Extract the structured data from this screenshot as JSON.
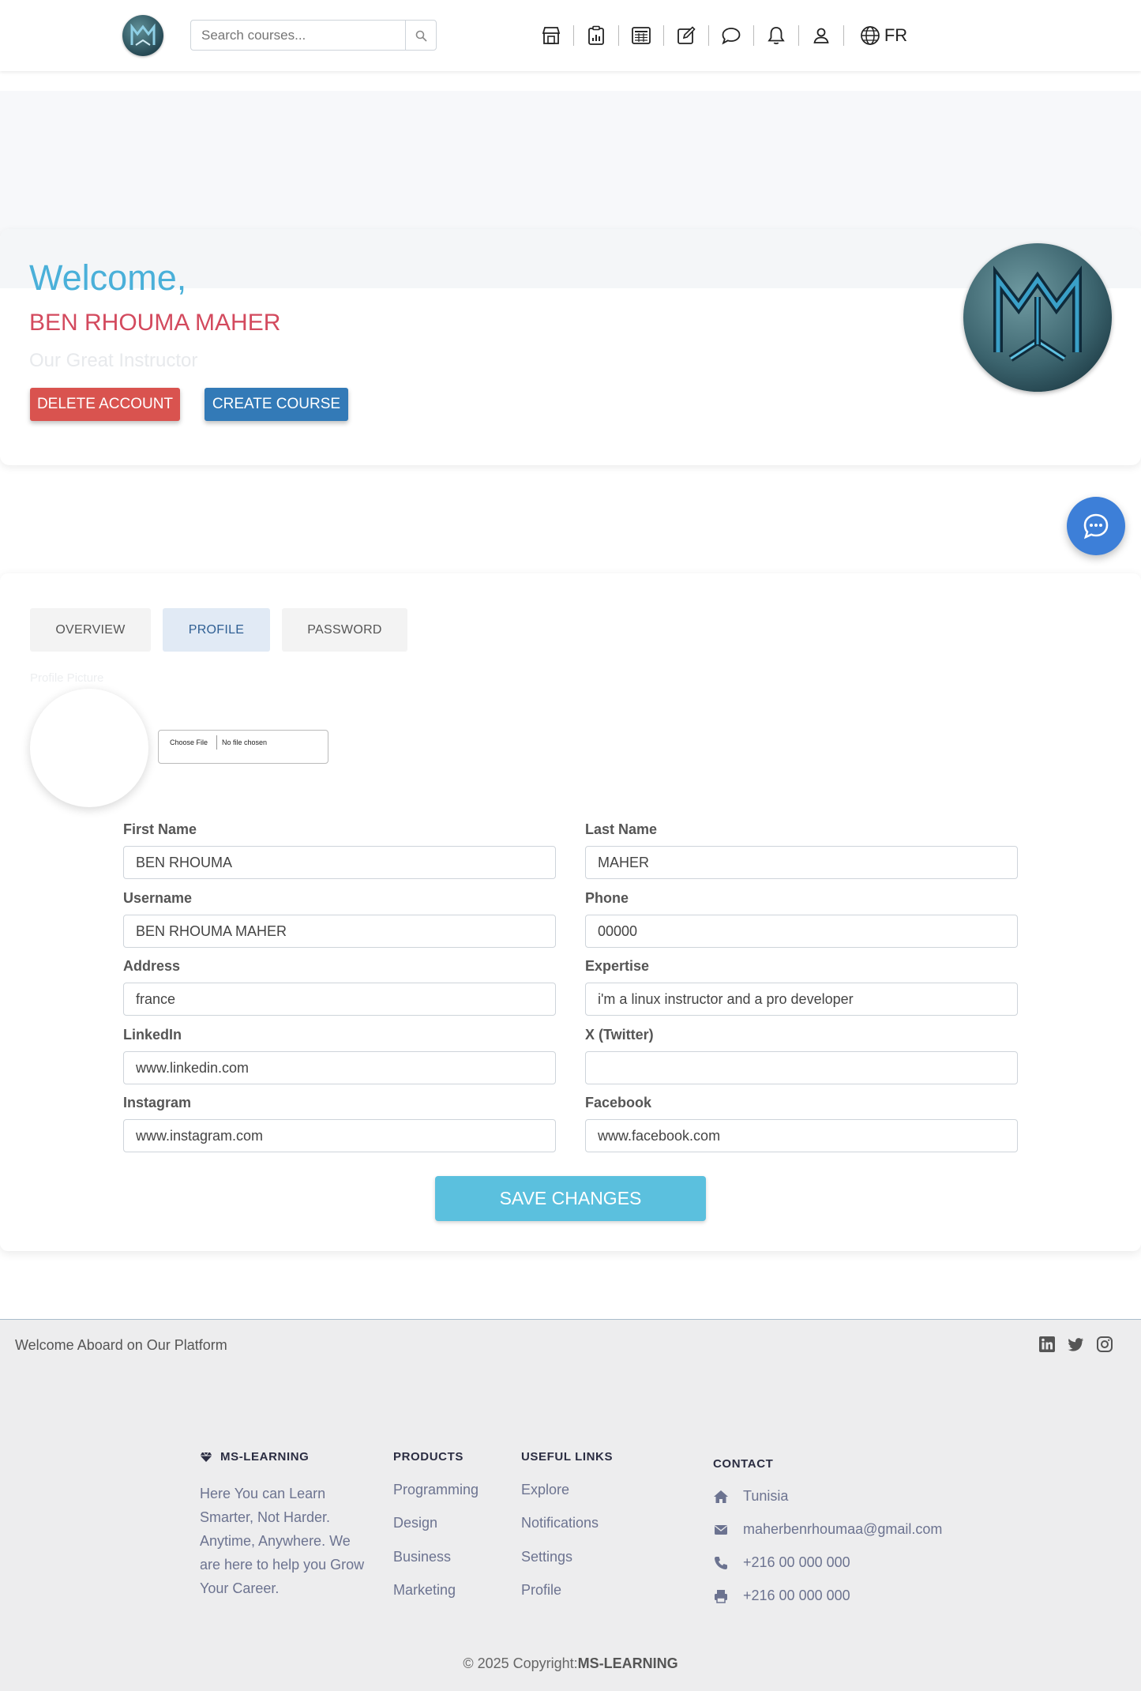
{
  "nav": {
    "search_placeholder": "Search courses...",
    "language": "FR"
  },
  "welcome": {
    "title": "Welcome,",
    "name": "BEN RHOUMA MAHER",
    "role": "Our Great Instructor",
    "delete_label": "DELETE ACCOUNT",
    "create_label": "CREATE COURSE"
  },
  "tabs": {
    "overview": "OVERVIEW",
    "profile": "PROFILE",
    "password": "PASSWORD"
  },
  "profile": {
    "picture_label": "Profile Picture",
    "file_button": "Choose File",
    "file_status": "No file chosen",
    "fields": {
      "first_name": {
        "label": "First Name",
        "value": "BEN RHOUMA"
      },
      "last_name": {
        "label": "Last Name",
        "value": "MAHER"
      },
      "username": {
        "label": "Username",
        "value": "BEN RHOUMA MAHER"
      },
      "phone": {
        "label": "Phone",
        "value": "00000"
      },
      "address": {
        "label": "Address",
        "value": "france"
      },
      "expertise": {
        "label": "Expertise",
        "value": "i'm a linux instructor and a pro developer"
      },
      "linkedin": {
        "label": "LinkedIn",
        "value": "www.linkedin.com"
      },
      "twitter": {
        "label": "X (Twitter)",
        "value": ""
      },
      "instagram": {
        "label": "Instagram",
        "value": "www.instagram.com"
      },
      "facebook": {
        "label": "Facebook",
        "value": "www.facebook.com"
      }
    },
    "save_label": "SAVE CHANGES"
  },
  "footer": {
    "tagline": "Welcome Aboard on Our Platform",
    "brand": "MS-LEARNING",
    "description": "Here You can Learn Smarter, Not Harder. Anytime, Anywhere. We are here to help you Grow Your Career.",
    "products_title": "PRODUCTS",
    "products": [
      "Programming",
      "Design",
      "Business",
      "Marketing"
    ],
    "links_title": "USEFUL LINKS",
    "links": [
      "Explore",
      "Notifications",
      "Settings",
      "Profile"
    ],
    "contact_title": "CONTACT",
    "contact": {
      "location": "Tunisia",
      "email": "maherbenrhoumaa@gmail.com",
      "phone": "+216 00 000 000",
      "fax": "+216 00 000 000"
    },
    "copyright_prefix": "© 2025 Copyright:",
    "copyright_brand": "MS-LEARNING"
  },
  "colors": {
    "welcome_title": "#4ab0d9",
    "welcome_name": "#d34a5e",
    "delete_button": "#d9534f",
    "create_button": "#337ab7",
    "save_button": "#5bc0de",
    "chat_button": "#3d7fd8"
  },
  "icons": {
    "nav": [
      "store-icon",
      "clipboard-chart-icon",
      "calculator-icon",
      "edit-icon",
      "chat-icon",
      "bell-icon",
      "user-icon",
      "globe-icon"
    ],
    "social": [
      "linkedin-icon",
      "twitter-icon",
      "instagram-icon"
    ]
  }
}
